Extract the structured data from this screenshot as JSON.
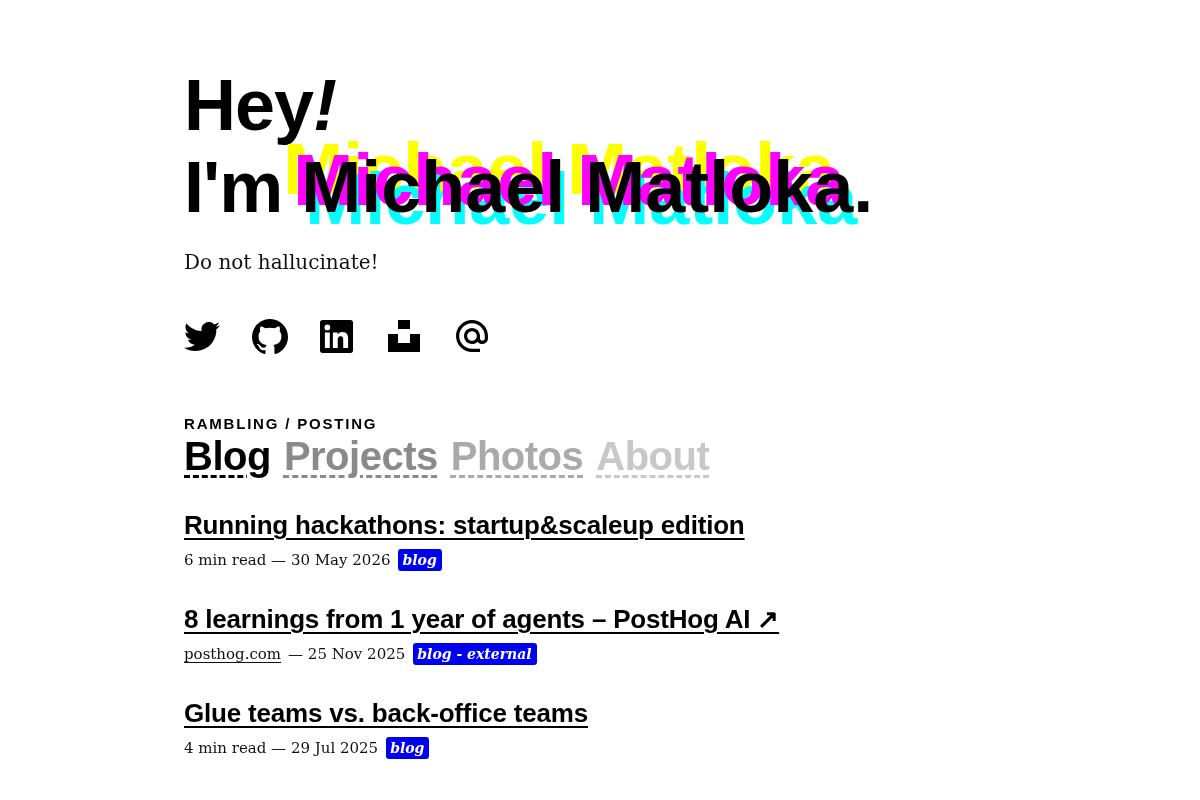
{
  "hero": {
    "greeting": "Hey!",
    "lead": "I'm",
    "name": "Michael Matloka",
    "end": ".",
    "tagline": "Do not hallucinate!"
  },
  "section": {
    "eyebrow": "RAMBLING / POSTING",
    "tabs": [
      {
        "label": "Blog",
        "selected": true
      },
      {
        "label": "Projects",
        "selected": false
      },
      {
        "label": "Photos",
        "selected": false
      },
      {
        "label": "About",
        "selected": false
      }
    ]
  },
  "posts": [
    {
      "title": "Running hackathons: startup&scaleup edition",
      "meta": "6 min read — 30 May 2026",
      "tag": "blog"
    },
    {
      "title": "8 learnings from 1 year of agents – PostHog AI ↗",
      "source": "posthog.com",
      "meta": "— 25 Nov 2025",
      "tag": "blog - external"
    },
    {
      "title": "Glue teams vs. back-office teams",
      "meta": "4 min read — 29 Jul 2025",
      "tag": "blog"
    }
  ]
}
